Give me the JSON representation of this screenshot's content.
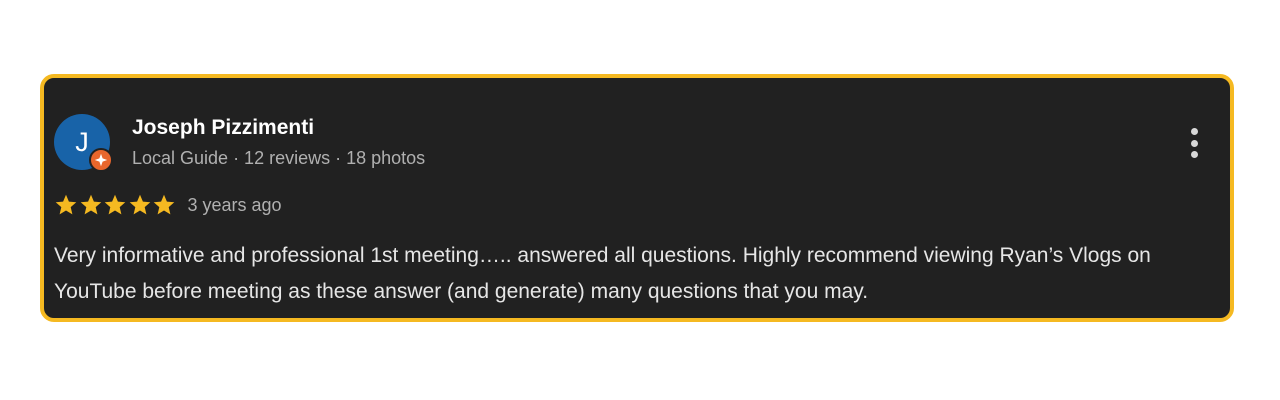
{
  "review": {
    "avatar_initial": "J",
    "avatar_color": "#1863a8",
    "badge_color": "#e8662c",
    "badge_icon": "local-guide-star-icon",
    "reviewer_name": "Joseph Pizzimenti",
    "reviewer_meta": "Local Guide · 12 reviews · 18 photos",
    "menu_icon": "more-vert-icon",
    "rating": 5,
    "rating_max": 5,
    "star_color": "#f5b921",
    "date": "3 years ago",
    "text": "Very informative and professional 1st meeting….. answered all questions. Highly recommend viewing Ryan’s Vlogs on YouTube before meeting as these answer (and generate) many questions that you may."
  },
  "theme": {
    "highlight_border": "#f5b921",
    "card_background": "#212121"
  }
}
